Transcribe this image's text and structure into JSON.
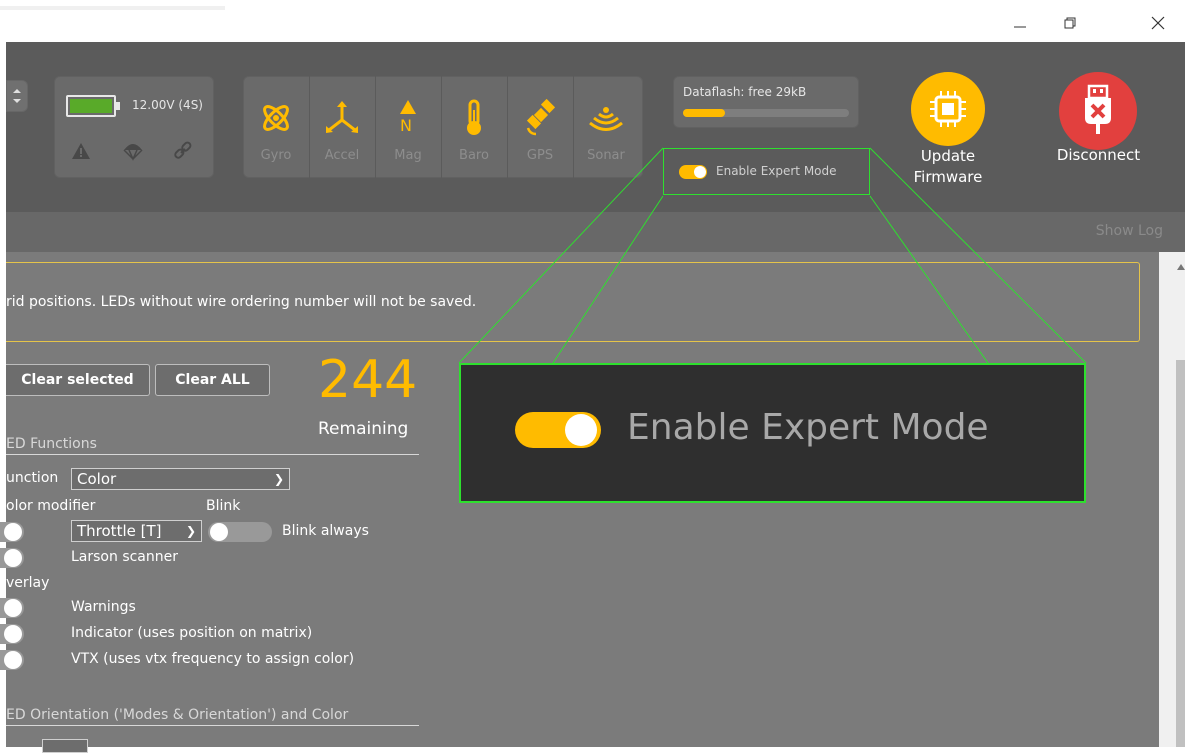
{
  "window": {
    "minimize_icon": "minimize-icon",
    "restore_icon": "restore-icon",
    "close_icon": "close-icon"
  },
  "header": {
    "battery": {
      "voltage": "12.00V (4S)",
      "fill_percent": 100,
      "fill_color": "#59aa29"
    },
    "status_icons": [
      "warning-icon",
      "parachute-icon",
      "link-icon"
    ],
    "sensors": [
      {
        "label": "Gyro",
        "icon": "gyro-icon"
      },
      {
        "label": "Accel",
        "icon": "accel-icon"
      },
      {
        "label": "Mag",
        "icon": "mag-icon",
        "glyph": "N"
      },
      {
        "label": "Baro",
        "icon": "baro-icon"
      },
      {
        "label": "GPS",
        "icon": "gps-icon"
      },
      {
        "label": "Sonar",
        "icon": "sonar-icon"
      }
    ],
    "dataflash": {
      "label": "Dataflash: free 29kB",
      "used_percent": 25
    },
    "expert_mode": {
      "label": "Enable Expert Mode",
      "enabled": true
    },
    "update_firmware": {
      "label_line1": "Update",
      "label_line2": "Firmware"
    },
    "disconnect": {
      "label": "Disconnect"
    }
  },
  "logbar": {
    "show_log": "Show Log"
  },
  "content": {
    "notice": "rid positions. LEDs without wire ordering number will not be saved.",
    "clear_selected": "Clear selected",
    "clear_all": "Clear ALL",
    "remaining_count": "244",
    "remaining_label": "Remaining",
    "led_functions_title": "ED Functions",
    "function_label": "unction",
    "function_value": "Color",
    "color_modifier_label": "olor modifier",
    "blink_label": "Blink",
    "throttle_value": "Throttle [T]",
    "blink_always": "Blink always",
    "larson_scanner": "Larson scanner",
    "overlay_label": "verlay",
    "warnings": "Warnings",
    "indicator": "Indicator (uses position on matrix)",
    "vtx": "VTX (uses vtx frequency to assign color)",
    "orientation_title": "ED Orientation ('Modes & Orientation') and Color"
  },
  "zoom": {
    "label": "Enable Expert Mode"
  },
  "colors": {
    "accent": "#ffbb00",
    "danger": "#e2403e",
    "highlight": "#2ee02e",
    "panel": "#5b5b5b"
  }
}
